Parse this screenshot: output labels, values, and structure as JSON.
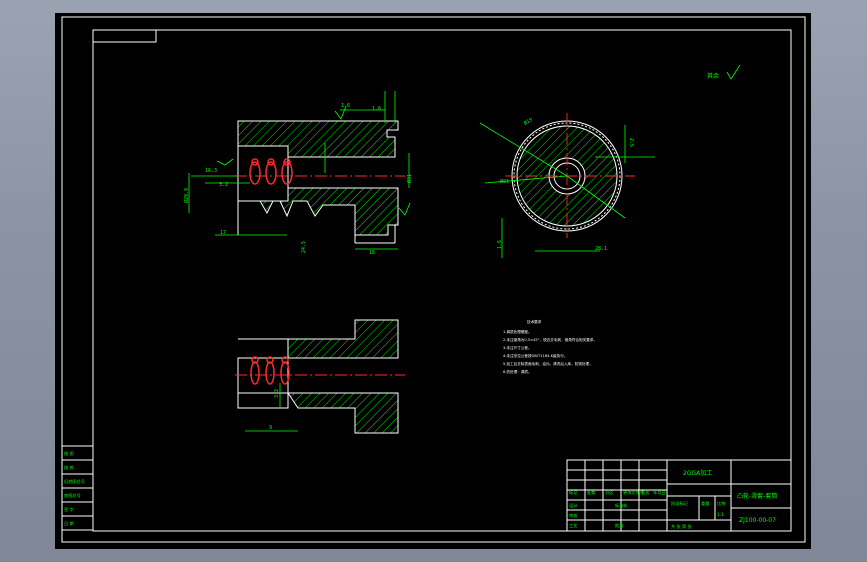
{
  "drawing": {
    "roughness_mark": "其余",
    "part_title": "2GGA加工",
    "part_name": "凸轮-滑套-套筒",
    "drawing_number": "ZJ100-00-07",
    "scale": "1:1",
    "tech_req_title": "技术要求",
    "tech_req_items": [
      "1.调质处理硬度。",
      "2.未注倒角为0.5×45°，锐边去毛刺，倒角符合相关要求。",
      "3.未注尺寸公差。",
      "4.未注形位公差按GB/T1184-K级执行。",
      "5.加工后去除表面毛刺，油污。清洗后入库，防锈处理。",
      "6.热处理：调质。"
    ],
    "left_table": [
      "描 图",
      "描 校",
      "旧底图总号",
      "底图总号",
      "签 字",
      "日 期"
    ],
    "title_block": {
      "row_labels": [
        "标记",
        "处数",
        "分区",
        "更改文件号",
        "签名",
        "年月日"
      ],
      "designer": "设计",
      "standardize": "标准化",
      "stage": "阶段标记",
      "weight": "重量",
      "scale_label": "比例",
      "check": "审核",
      "process": "工艺",
      "approve": "批准",
      "sheets": "共  张  第  张"
    },
    "dims": {
      "d1": "1.6",
      "d2": "1.6",
      "d3": "16.3",
      "d4": "Ø31",
      "d5": "Ø29.9",
      "d6": "17",
      "d7": "24.5",
      "d8": "16",
      "d9": "3.2",
      "d10": "9",
      "d11": "48",
      "d12": "Ø15",
      "d13": "Ø21",
      "d14": "2.5",
      "d15": "1.6",
      "d16": "3.2",
      "d17": "28.1"
    }
  }
}
